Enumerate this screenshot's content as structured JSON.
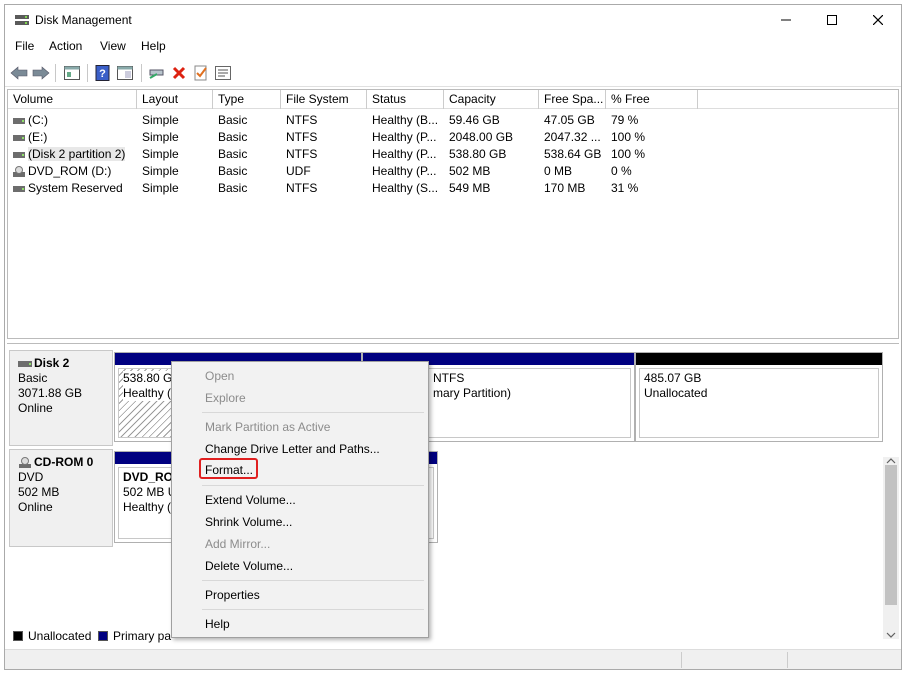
{
  "window": {
    "title": "Disk Management"
  },
  "colors": {
    "primary_partition": "#000080",
    "unallocated": "#000000",
    "highlight": "#e02020"
  },
  "menubar": {
    "items": [
      "File",
      "Action",
      "View",
      "Help"
    ]
  },
  "toolbar": {
    "icons": [
      "back-icon",
      "forward-icon",
      "properties-icon",
      "help-icon",
      "console-icon",
      "connect-icon",
      "delete-icon",
      "check-icon",
      "settings-icon"
    ]
  },
  "volume_list": {
    "columns": [
      "Volume",
      "Layout",
      "Type",
      "File System",
      "Status",
      "Capacity",
      "Free Spa...",
      "% Free"
    ],
    "rows": [
      [
        "(C:)",
        "Simple",
        "Basic",
        "NTFS",
        "Healthy (B...",
        "59.46 GB",
        "47.05 GB",
        "79 %"
      ],
      [
        "(E:)",
        "Simple",
        "Basic",
        "NTFS",
        "Healthy (P...",
        "2048.00 GB",
        "2047.32 ...",
        "100 %"
      ],
      [
        "(Disk 2 partition 2)",
        "Simple",
        "Basic",
        "NTFS",
        "Healthy (P...",
        "538.80 GB",
        "538.64 GB",
        "100 %"
      ],
      [
        "DVD_ROM (D:)",
        "Simple",
        "Basic",
        "UDF",
        "Healthy (P...",
        "502 MB",
        "0 MB",
        "0 %"
      ],
      [
        "System Reserved",
        "Simple",
        "Basic",
        "NTFS",
        "Healthy (S...",
        "549 MB",
        "170 MB",
        "31 %"
      ]
    ]
  },
  "disks": {
    "disk2": {
      "name": "Disk 2",
      "type": "Basic",
      "size": "3071.88 GB",
      "status": "Online",
      "p1": {
        "line1": "538.80 GB",
        "line2": "Healthy (P"
      },
      "p2": {
        "line1": "NTFS",
        "line2": "mary Partition)"
      },
      "p3": {
        "line1": "485.07 GB",
        "line2": "Unallocated"
      }
    },
    "cdrom0": {
      "name": "CD-ROM 0",
      "type": "DVD",
      "size": "502 MB",
      "status": "Online",
      "p1": {
        "line1": "DVD_RO",
        "line2": "502 MB U",
        "line3": "Healthy ("
      }
    }
  },
  "legend": {
    "unallocated": "Unallocated",
    "primary": "Primary pa"
  },
  "context_menu": {
    "open": "Open",
    "explore": "Explore",
    "mark_active": "Mark Partition as Active",
    "change_letter": "Change Drive Letter and Paths...",
    "format": "Format...",
    "extend": "Extend Volume...",
    "shrink": "Shrink Volume...",
    "add_mirror": "Add Mirror...",
    "delete": "Delete Volume...",
    "properties": "Properties",
    "help": "Help"
  }
}
